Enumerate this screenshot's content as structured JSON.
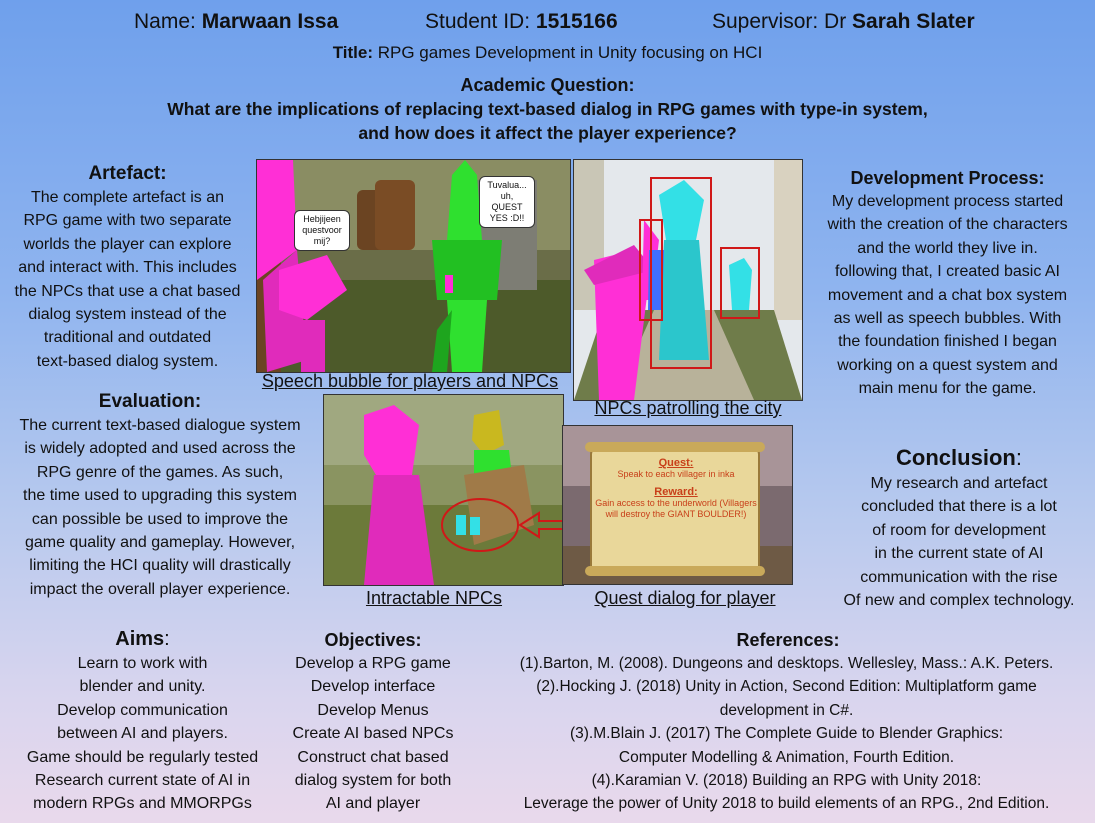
{
  "header": {
    "name_label": "Name:",
    "name_value": "Marwaan Issa",
    "id_label": "Student ID:",
    "id_value": "1515166",
    "supervisor_label": "Supervisor: Dr",
    "supervisor_value": "Sarah Slater",
    "title_label": "Title:",
    "title_value": "RPG games Development in Unity focusing on HCI"
  },
  "question": {
    "heading": "Academic Question:",
    "line1": "What are the implications of replacing text-based dialog in RPG games with type-in system,",
    "line2": "and how does it affect the player experience?"
  },
  "artefact": {
    "heading": "Artefact:",
    "lines": [
      "The complete artefact is an",
      "RPG game with two separate",
      "worlds the player can explore",
      "and interact with. This includes",
      "the NPCs that use a chat based",
      "dialog system instead of the",
      "traditional and outdated",
      "text-based dialog system."
    ]
  },
  "evaluation": {
    "heading": "Evaluation:",
    "lines": [
      "The current text-based dialogue system",
      "is widely adopted and used across the",
      "RPG genre of the games. As such,",
      "the time used to upgrading this system",
      "can possible be used to improve the",
      "game quality and gameplay. However,",
      "limiting the HCI quality will drastically",
      "impact the overall player experience."
    ]
  },
  "development": {
    "heading": "Development Process:",
    "lines": [
      "My development process started",
      "with the creation of the characters",
      "and the world they live in.",
      "following that, I created  basic AI",
      "movement  and a chat box system",
      "as well as speech bubbles. With",
      "the foundation finished  I began",
      "working on a quest system and",
      "main menu for the game."
    ]
  },
  "conclusion": {
    "heading": "Conclusion",
    "colon": ":",
    "lines": [
      "My research and artefact",
      "concluded that there is a lot",
      "of room for development",
      "in the current state of AI",
      "communication with the rise",
      "Of new and complex technology."
    ]
  },
  "aims": {
    "heading": "Aims",
    "colon": ":",
    "lines": [
      "Learn to work with",
      "blender and unity.",
      "Develop communication",
      "between AI and players.",
      "Game should be regularly tested",
      "Research current state of AI in",
      "modern RPGs and MMORPGs"
    ]
  },
  "objectives": {
    "heading": "Objectives:",
    "lines": [
      "Develop a RPG game",
      "Develop interface",
      "Develop Menus",
      "Create AI based NPCs",
      "Construct chat based",
      "dialog system for both",
      "AI and player"
    ]
  },
  "references": {
    "heading": "References:",
    "lines": [
      "(1).Barton, M. (2008). Dungeons and desktops. Wellesley, Mass.: A.K. Peters.",
      "(2).Hocking J. (2018) Unity in Action, Second Edition: Multiplatform game",
      "development in C#.",
      "(3).M.Blain J. (2017) The Complete Guide to Blender Graphics:",
      "Computer Modelling & Animation, Fourth Edition.",
      "(4).Karamian V. (2018) Building an RPG with Unity 2018:",
      "Leverage the power of Unity 2018 to build elements of an RPG., 2nd Edition."
    ]
  },
  "captions": {
    "speech": "Speech bubble for players and NPCs",
    "patrol": "NPCs patrolling the city",
    "intractable": "Intractable NPCs",
    "quest": "Quest dialog for player"
  },
  "screens": {
    "bubble1": "Hebjijeen questvoor mij?",
    "bubble2": "Tuvalua... uh, QUEST YES :D!!",
    "quest_label": "Quest:",
    "quest_text": "Speak to each villager in inka",
    "reward_label": "Reward:",
    "reward_text": "Gain access to the underworld (Villagers will destroy the GIANT BOULDER!)"
  },
  "colors": {
    "npc_pink": "#ff2fd6",
    "npc_green": "#2fe02f",
    "npc_cyan": "#33e0e6",
    "highlight_red": "#d01818",
    "scroll": "#e9d79a"
  }
}
